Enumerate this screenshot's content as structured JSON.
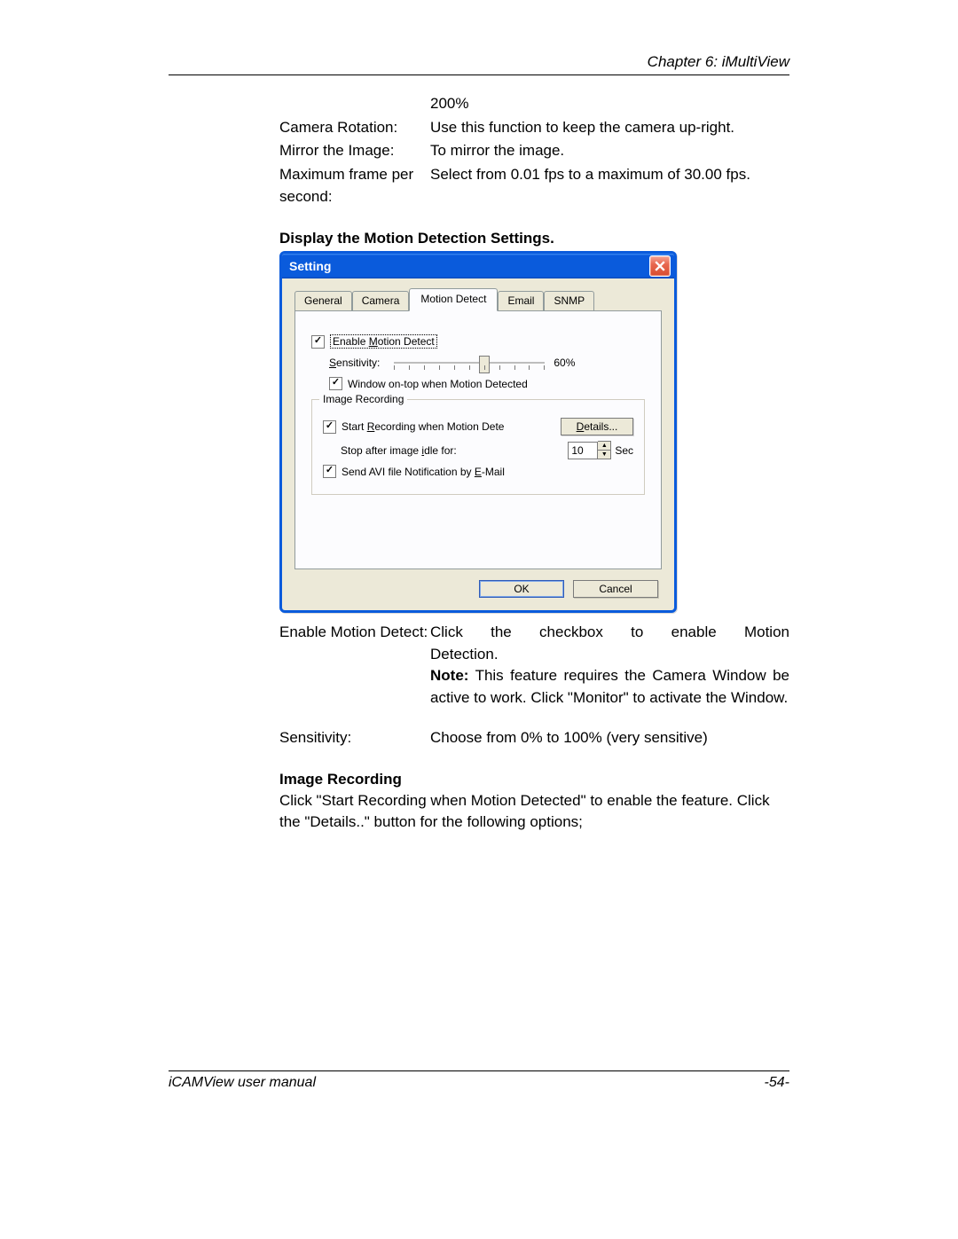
{
  "header": {
    "chapter": "Chapter 6: iMultiView"
  },
  "pre_rows": {
    "zoom_value": "200%",
    "row1_label": "Camera Rotation:",
    "row1_desc": "Use this function to keep the camera up-right.",
    "row2_label": "Mirror the Image:",
    "row2_desc": "To mirror the image.",
    "row3_label": "Maximum frame per second:",
    "row3_desc": "Select from 0.01 fps to a maximum of 30.00 fps."
  },
  "section1_heading": "Display the Motion Detection Settings",
  "dialog": {
    "title": "Setting",
    "tabs": [
      "General",
      "Camera",
      "Motion Detect",
      "Email",
      "SNMP"
    ],
    "active_tab": 2,
    "enable_label": "Enable Motion Detect",
    "sensitivity_label": "Sensitivity:",
    "sensitivity_value": "60%",
    "ontop_label": "Window on-top when Motion Detected",
    "group_label": "Image Recording",
    "start_rec_label": "Start Recording when Motion Dete",
    "details_btn": "Details...",
    "stop_label": "Stop after image idle for:",
    "stop_value": "10",
    "stop_unit": "Sec",
    "avi_label": "Send AVI file Notification by E-Mail",
    "ok": "OK",
    "cancel": "Cancel"
  },
  "post_rows": {
    "row1_label": "Enable Motion Detect:",
    "row1_desc1": "Click the checkbox to enable Motion Detection.",
    "row1_note_label": "Note:",
    "row1_note": " This feature requires the Camera Window be active to work. Click \"Monitor\" to activate the Window.",
    "row2_label": "Sensitivity:",
    "row2_desc": "Choose from 0% to 100% (very sensitive)"
  },
  "section2_heading": "Image Recording",
  "section2_body": "Click \"Start Recording when Motion Detected\" to enable the feature. Click the \"Details..\" button for the following options;",
  "footer": {
    "left": "iCAMView  user  manual",
    "right": "-54-"
  }
}
